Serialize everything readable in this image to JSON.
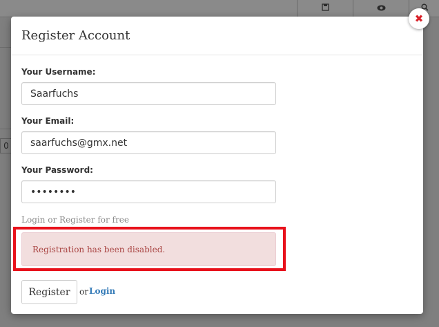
{
  "modal": {
    "title": "Register Account",
    "fields": {
      "username": {
        "label": "Your Username:",
        "value": "Saarfuchs"
      },
      "email": {
        "label": "Your Email:",
        "value": "saarfuchs@gmx.net"
      },
      "password": {
        "label": "Your Password:",
        "value": "••••••••"
      }
    },
    "hint": "Login or Register for free",
    "alert": "Registration has been disabled.",
    "register_label": "Register",
    "or_text": "or",
    "login_label": "Login",
    "close_glyph": "✖"
  },
  "background": {
    "zero_cell": "0",
    "icons": [
      "save-icon",
      "eye-icon",
      "search-icon"
    ]
  },
  "colors": {
    "alert_bg": "#f2dede",
    "alert_text": "#a94442",
    "highlight": "#e8111b",
    "link": "#337ab7"
  }
}
